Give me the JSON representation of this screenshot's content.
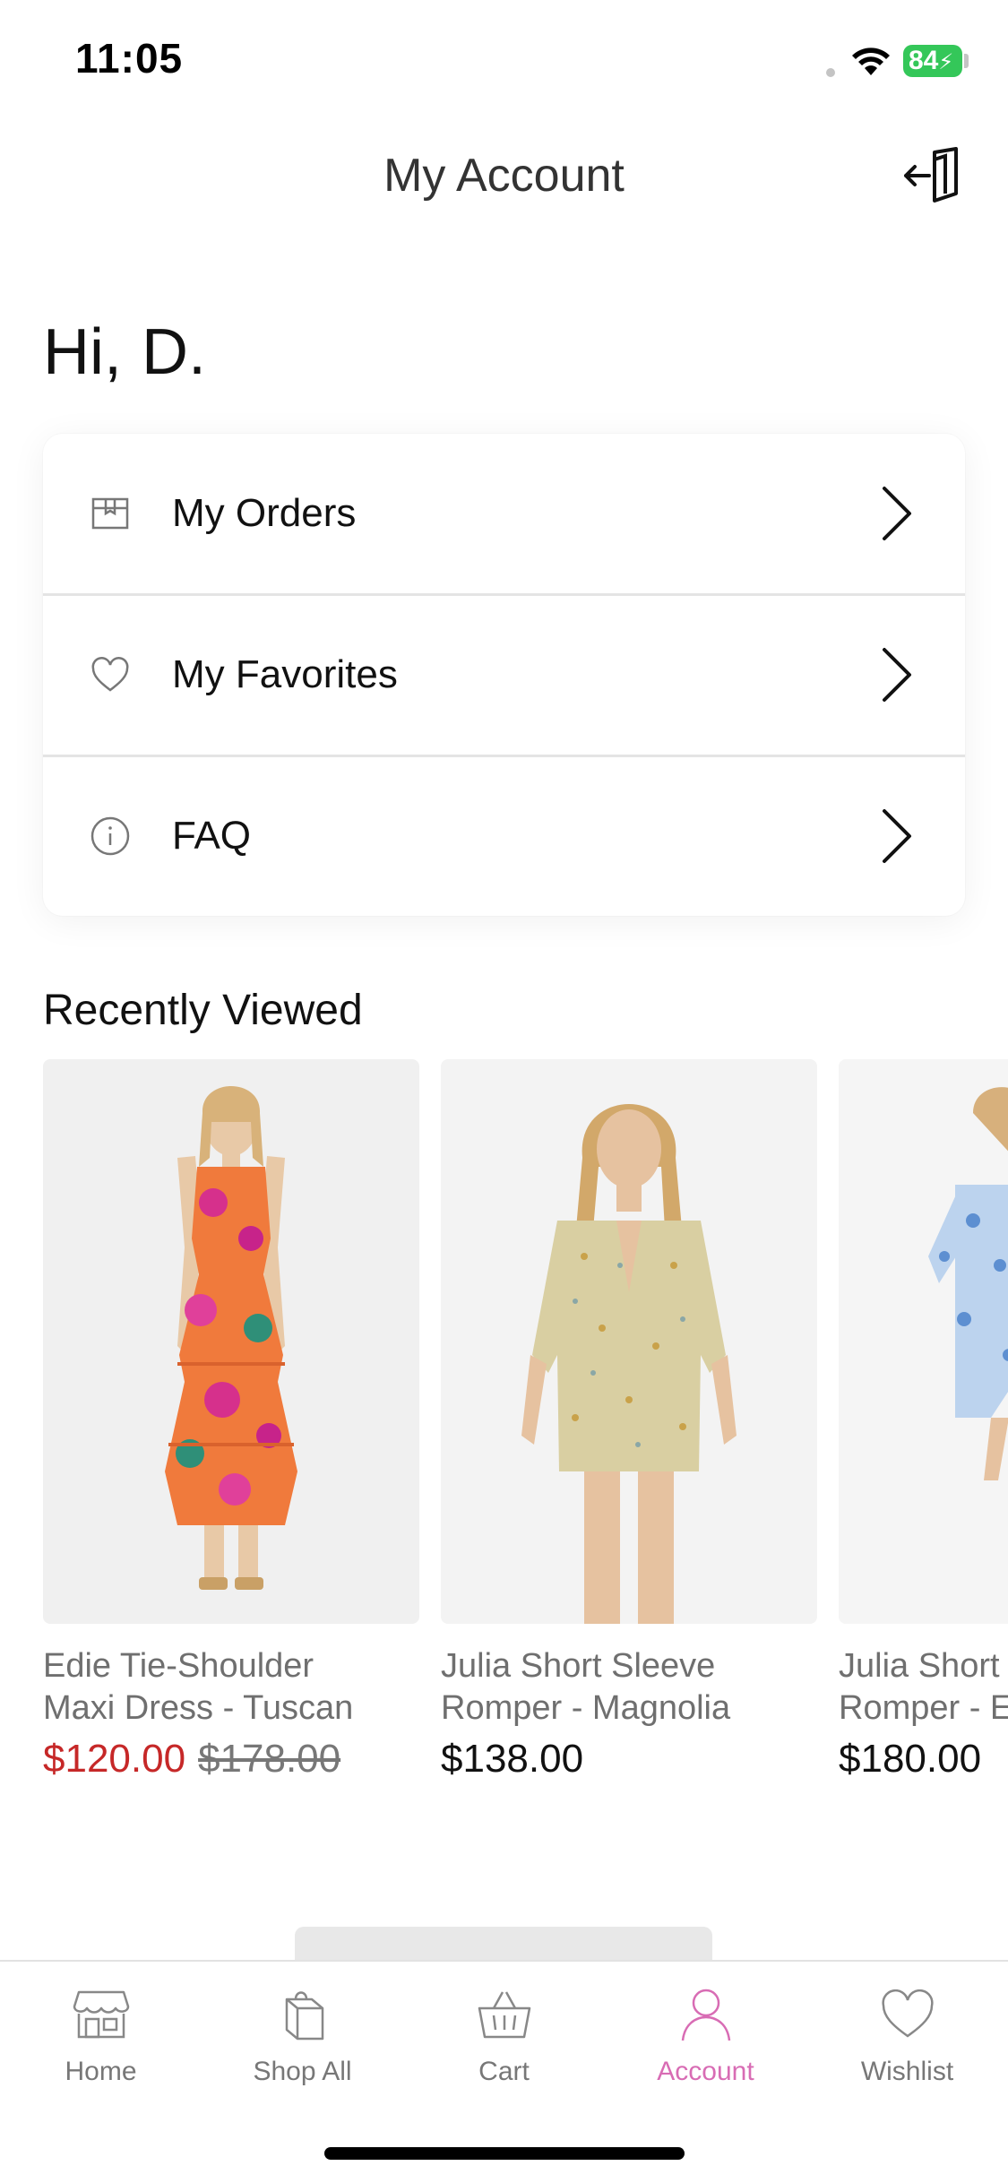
{
  "status_bar": {
    "time": "11:05",
    "battery": "84"
  },
  "header": {
    "title": "My Account"
  },
  "greeting": {
    "hi": "Hi,",
    "name": "D."
  },
  "menu": {
    "items": [
      {
        "label": "My Orders",
        "icon": "box-icon"
      },
      {
        "label": "My Favorites",
        "icon": "heart-icon"
      },
      {
        "label": "FAQ",
        "icon": "info-icon"
      }
    ]
  },
  "recently_viewed": {
    "title": "Recently Viewed",
    "products": [
      {
        "name_line1": "Edie Tie-Shoulder",
        "name_line2": "Maxi Dress - Tuscan",
        "price": "$120.00",
        "original_price": "$178.00"
      },
      {
        "name_line1": "Julia Short Sleeve",
        "name_line2": "Romper - Magnolia",
        "price": "$138.00"
      },
      {
        "name_line1": "Julia Short",
        "name_line2": "Romper - E",
        "price": "$180.00"
      }
    ]
  },
  "tab_bar": {
    "tabs": [
      {
        "label": "Home",
        "icon": "storefront-icon"
      },
      {
        "label": "Shop All",
        "icon": "shopping-bag-icon"
      },
      {
        "label": "Cart",
        "icon": "basket-icon"
      },
      {
        "label": "Account",
        "icon": "person-icon",
        "active": true
      },
      {
        "label": "Wishlist",
        "icon": "heart-icon"
      }
    ]
  },
  "colors": {
    "accent": "#d86cb4",
    "sale": "#c62828",
    "battery": "#34c759"
  }
}
